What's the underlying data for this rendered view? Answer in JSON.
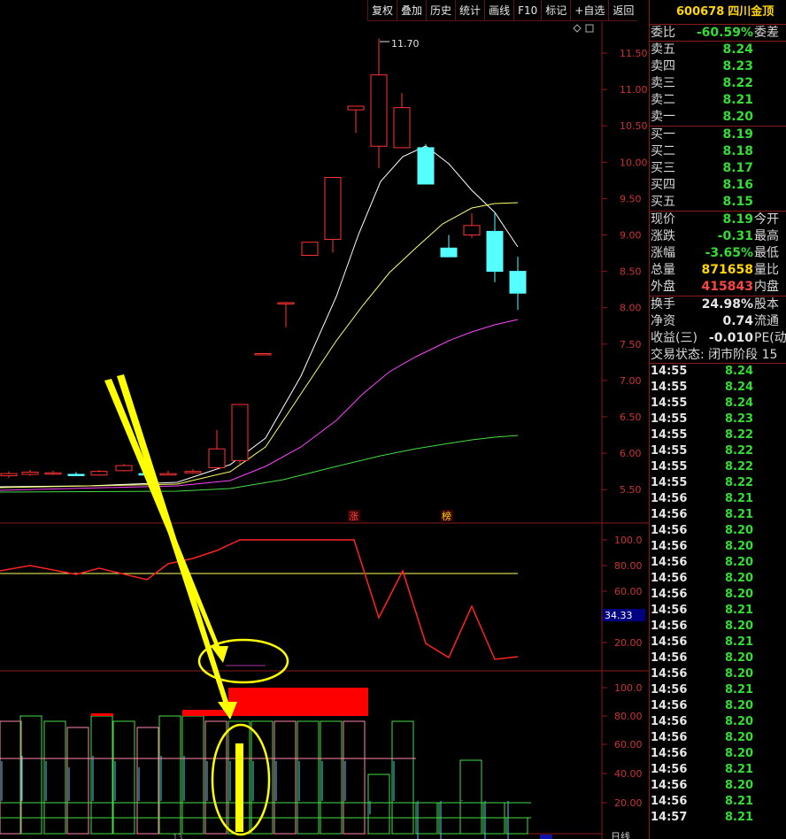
{
  "toolbar": {
    "items": [
      "复权",
      "叠加",
      "历史",
      "统计",
      "画线",
      "F10",
      "标记",
      "+自选",
      "返回"
    ]
  },
  "main_chart": {
    "price_ticks": [
      "11.50",
      "11.00",
      "10.50",
      "10.00",
      "9.50",
      "9.00",
      "8.50",
      "8.00",
      "7.50",
      "7.00",
      "6.50",
      "6.00",
      "5.50"
    ],
    "high_label": "11.70",
    "event_marks": [
      "涨",
      "榜"
    ]
  },
  "indicator1": {
    "ticks": [
      "100.0",
      "80.00",
      "60.00",
      "40.00",
      "20.00"
    ],
    "current_value": "34.33"
  },
  "indicator2": {
    "ticks": [
      "100.0",
      "80.00",
      "60.00",
      "40.00",
      "20.00"
    ]
  },
  "bottom_bar": {
    "left_text": "13",
    "right_text": "日线"
  },
  "quote": {
    "code": "600678",
    "name": "四川金顶",
    "weibi": {
      "label": "委比",
      "value": "-60.59%",
      "label2": "委差"
    },
    "sell": [
      {
        "label": "卖五",
        "price": "8.24"
      },
      {
        "label": "卖四",
        "price": "8.23"
      },
      {
        "label": "卖三",
        "price": "8.22"
      },
      {
        "label": "卖二",
        "price": "8.21"
      },
      {
        "label": "卖一",
        "price": "8.20"
      }
    ],
    "buy": [
      {
        "label": "买一",
        "price": "8.19"
      },
      {
        "label": "买二",
        "price": "8.18"
      },
      {
        "label": "买三",
        "price": "8.17"
      },
      {
        "label": "买四",
        "price": "8.16"
      },
      {
        "label": "买五",
        "price": "8.15"
      }
    ],
    "stats1": [
      {
        "label": "现价",
        "value": "8.19",
        "label2": "今开",
        "color": "green"
      },
      {
        "label": "涨跌",
        "value": "-0.31",
        "label2": "最高",
        "color": "green"
      },
      {
        "label": "涨幅",
        "value": "-3.65%",
        "label2": "最低",
        "color": "green"
      },
      {
        "label": "总量",
        "value": "871658",
        "label2": "量比",
        "color": "yellow"
      },
      {
        "label": "外盘",
        "value": "415843",
        "label2": "内盘",
        "color": "red"
      }
    ],
    "stats2": [
      {
        "label": "换手",
        "value": "24.98%",
        "label2": "股本",
        "color": "white"
      },
      {
        "label": "净资",
        "value": "0.74",
        "label2": "流通",
        "color": "white"
      },
      {
        "label": "收益(三)",
        "value": "-0.010",
        "label2": "PE(动",
        "color": "white"
      }
    ],
    "status": "交易状态: 闭市阶段 15"
  },
  "ticks": [
    {
      "time": "14:55",
      "price": "8.24"
    },
    {
      "time": "14:55",
      "price": "8.24"
    },
    {
      "time": "14:55",
      "price": "8.24"
    },
    {
      "time": "14:55",
      "price": "8.23"
    },
    {
      "time": "14:55",
      "price": "8.22"
    },
    {
      "time": "14:55",
      "price": "8.22"
    },
    {
      "time": "14:55",
      "price": "8.22"
    },
    {
      "time": "14:55",
      "price": "8.22"
    },
    {
      "time": "14:56",
      "price": "8.21"
    },
    {
      "time": "14:56",
      "price": "8.21"
    },
    {
      "time": "14:56",
      "price": "8.20"
    },
    {
      "time": "14:56",
      "price": "8.20"
    },
    {
      "time": "14:56",
      "price": "8.20"
    },
    {
      "time": "14:56",
      "price": "8.20"
    },
    {
      "time": "14:56",
      "price": "8.20"
    },
    {
      "time": "14:56",
      "price": "8.21"
    },
    {
      "time": "14:56",
      "price": "8.20"
    },
    {
      "time": "14:56",
      "price": "8.21"
    },
    {
      "time": "14:56",
      "price": "8.20"
    },
    {
      "time": "14:56",
      "price": "8.20"
    },
    {
      "time": "14:56",
      "price": "8.21"
    },
    {
      "time": "14:56",
      "price": "8.20"
    },
    {
      "time": "14:56",
      "price": "8.20"
    },
    {
      "time": "14:56",
      "price": "8.20"
    },
    {
      "time": "14:56",
      "price": "8.20"
    },
    {
      "time": "14:56",
      "price": "8.21"
    },
    {
      "time": "14:56",
      "price": "8.20"
    },
    {
      "time": "14:56",
      "price": "8.21"
    },
    {
      "time": "14:57",
      "price": "8.21"
    }
  ],
  "colors": {
    "up": "#ff3333",
    "down": "#55ffff",
    "grid": "#8b1a1a",
    "annotation": "#ffff00"
  }
}
